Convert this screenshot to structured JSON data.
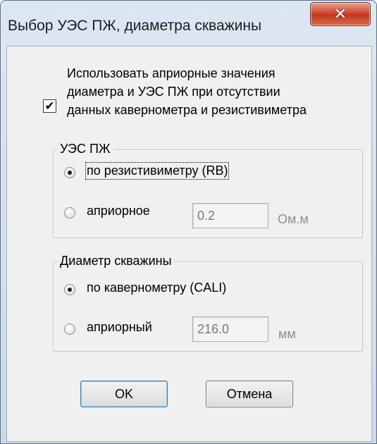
{
  "window": {
    "title": "Выбор УЭС ПЖ, диаметра скважины"
  },
  "option": {
    "checked": true,
    "line1": "Использовать априорные значения",
    "line2": "диаметра и УЭС ПЖ при отсутствии",
    "line3": "данных кавернометра и резистивиметра"
  },
  "resistivity_group": {
    "legend": "УЭС ПЖ",
    "option_measured": "по резистивиметру (RB)",
    "option_apriori": "априорное",
    "selected": "option_measured",
    "value": "0.2",
    "unit": "Ом.м"
  },
  "diameter_group": {
    "legend": "Диаметр скважины",
    "option_measured": "по кавернометру (CALI)",
    "option_apriori": "априорный",
    "selected": "option_measured",
    "value": "216.0",
    "unit": "мм"
  },
  "buttons": {
    "ok": "OK",
    "cancel": "Отмена"
  }
}
